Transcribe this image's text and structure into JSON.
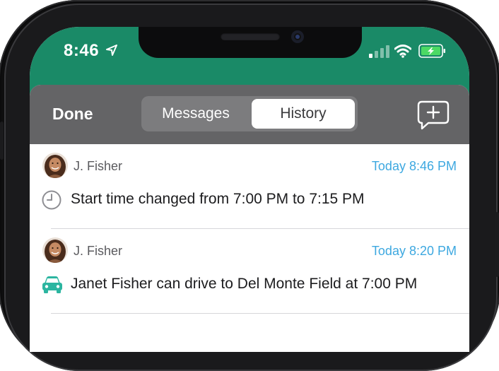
{
  "status_bar": {
    "time": "8:46",
    "icons": [
      "location-arrow-icon",
      "cellular-signal-icon",
      "wifi-icon",
      "battery-charging-icon"
    ]
  },
  "colors": {
    "header_green": "#1a8a67",
    "toolbar_gray": "#646466",
    "timestamp_blue": "#3da8e0",
    "car_teal": "#2bb5a0",
    "battery_green": "#4cd964"
  },
  "toolbar": {
    "done_label": "Done",
    "segments": [
      {
        "label": "Messages",
        "selected": false
      },
      {
        "label": "History",
        "selected": true
      }
    ],
    "compose_icon": "add-message-icon"
  },
  "history": [
    {
      "author": "J. Fisher",
      "timestamp": "Today 8:46 PM",
      "icon": "clock-icon",
      "text": "Start time changed from 7:00 PM to 7:15 PM"
    },
    {
      "author": "J. Fisher",
      "timestamp": "Today 8:20 PM",
      "icon": "car-icon",
      "text": "Janet Fisher can drive to Del Monte Field at 7:00 PM"
    }
  ]
}
